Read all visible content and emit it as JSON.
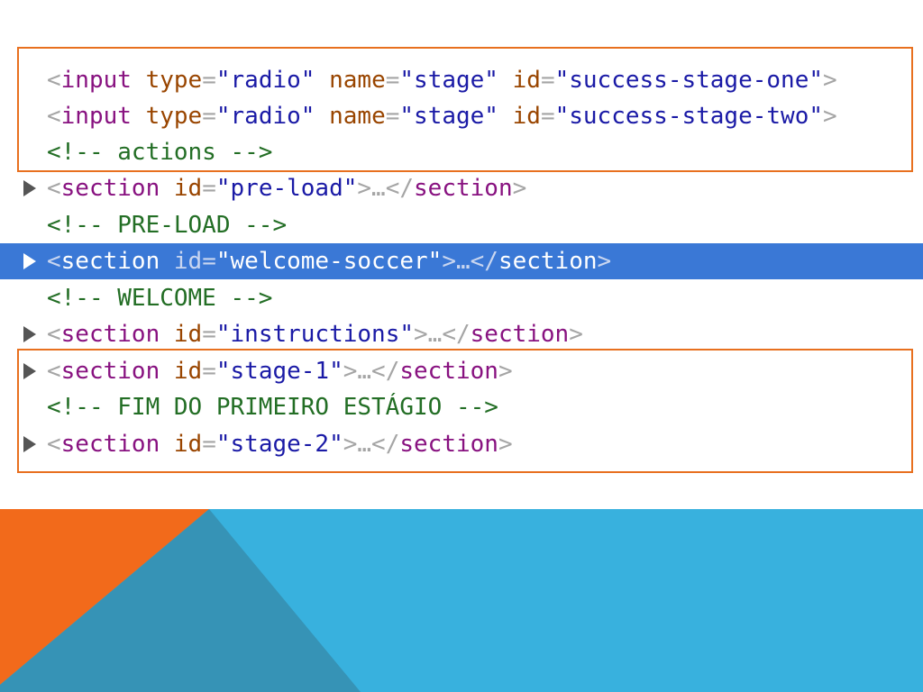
{
  "lines": [
    {
      "t": "<input type=\"radio\" name=\"stage\" id=\"success-stage-one\">"
    },
    {
      "t": "<input type=\"radio\" name=\"stage\" id=\"success-stage-two\">"
    },
    {
      "t": "<!-- actions -->"
    },
    {
      "t": "<section id=\"pre-load\">…</section>"
    },
    {
      "t": "<!-- PRE-LOAD -->"
    },
    {
      "t": "<section id=\"welcome-soccer\">…</section>"
    },
    {
      "t": "<!-- WELCOME -->"
    },
    {
      "t": "<section id=\"instructions\">…</section>"
    },
    {
      "t": "<section id=\"stage-1\">…</section>"
    },
    {
      "t": "<!-- FIM DO PRIMEIRO ESTÁGIO -->"
    },
    {
      "t": "<section id=\"stage-2\">…</section>"
    }
  ],
  "parts": {
    "l1": {
      "open": "<",
      "tag": "input",
      "a1": "type",
      "eq": "=",
      "v1": "\"radio\"",
      "a2": "name",
      "v2": "\"stage\"",
      "a3": "id",
      "v3": "\"success-stage-one\"",
      "close": ">"
    },
    "l2": {
      "open": "<",
      "tag": "input",
      "a1": "type",
      "eq": "=",
      "v1": "\"radio\"",
      "a2": "name",
      "v2": "\"stage\"",
      "a3": "id",
      "v3": "\"success-stage-two\"",
      "close": ">"
    },
    "l3": {
      "comment": "<!-- actions -->"
    },
    "l4": {
      "open": "<",
      "tag": "section",
      "a1": "id",
      "eq": "=",
      "v1": "\"pre-load\"",
      "mid": ">…</",
      "endtag": "section",
      "close": ">"
    },
    "l5": {
      "comment": "<!-- PRE-LOAD -->"
    },
    "l6": {
      "open": "<",
      "tag": "section",
      "a1": "id",
      "eq": "=",
      "v1": "\"welcome-soccer\"",
      "mid": ">…</",
      "endtag": "section",
      "close": ">"
    },
    "l7": {
      "comment": "<!-- WELCOME -->"
    },
    "l8": {
      "open": "<",
      "tag": "section",
      "a1": "id",
      "eq": "=",
      "v1": "\"instructions\"",
      "mid": ">…</",
      "endtag": "section",
      "close": ">"
    },
    "l9": {
      "open": "<",
      "tag": "section",
      "a1": "id",
      "eq": "=",
      "v1": "\"stage-1\"",
      "mid": ">…</",
      "endtag": "section",
      "close": ">"
    },
    "l10": {
      "comment": "<!-- FIM DO PRIMEIRO ESTÁGIO -->"
    },
    "l11": {
      "open": "<",
      "tag": "section",
      "a1": "id",
      "eq": "=",
      "v1": "\"stage-2\"",
      "mid": ">…</",
      "endtag": "section",
      "close": ">"
    }
  },
  "selected_line": "welcome-soccer",
  "colors": {
    "highlight_box": "#e8701f",
    "selection": "#3a78d6",
    "tag": "#881280",
    "attr_name": "#994500",
    "attr_value": "#1a1aa6",
    "comment": "#236e25",
    "slide_orange": "#f26a1b",
    "slide_blue": "#38b1de",
    "slide_teal": "#3693b6"
  }
}
